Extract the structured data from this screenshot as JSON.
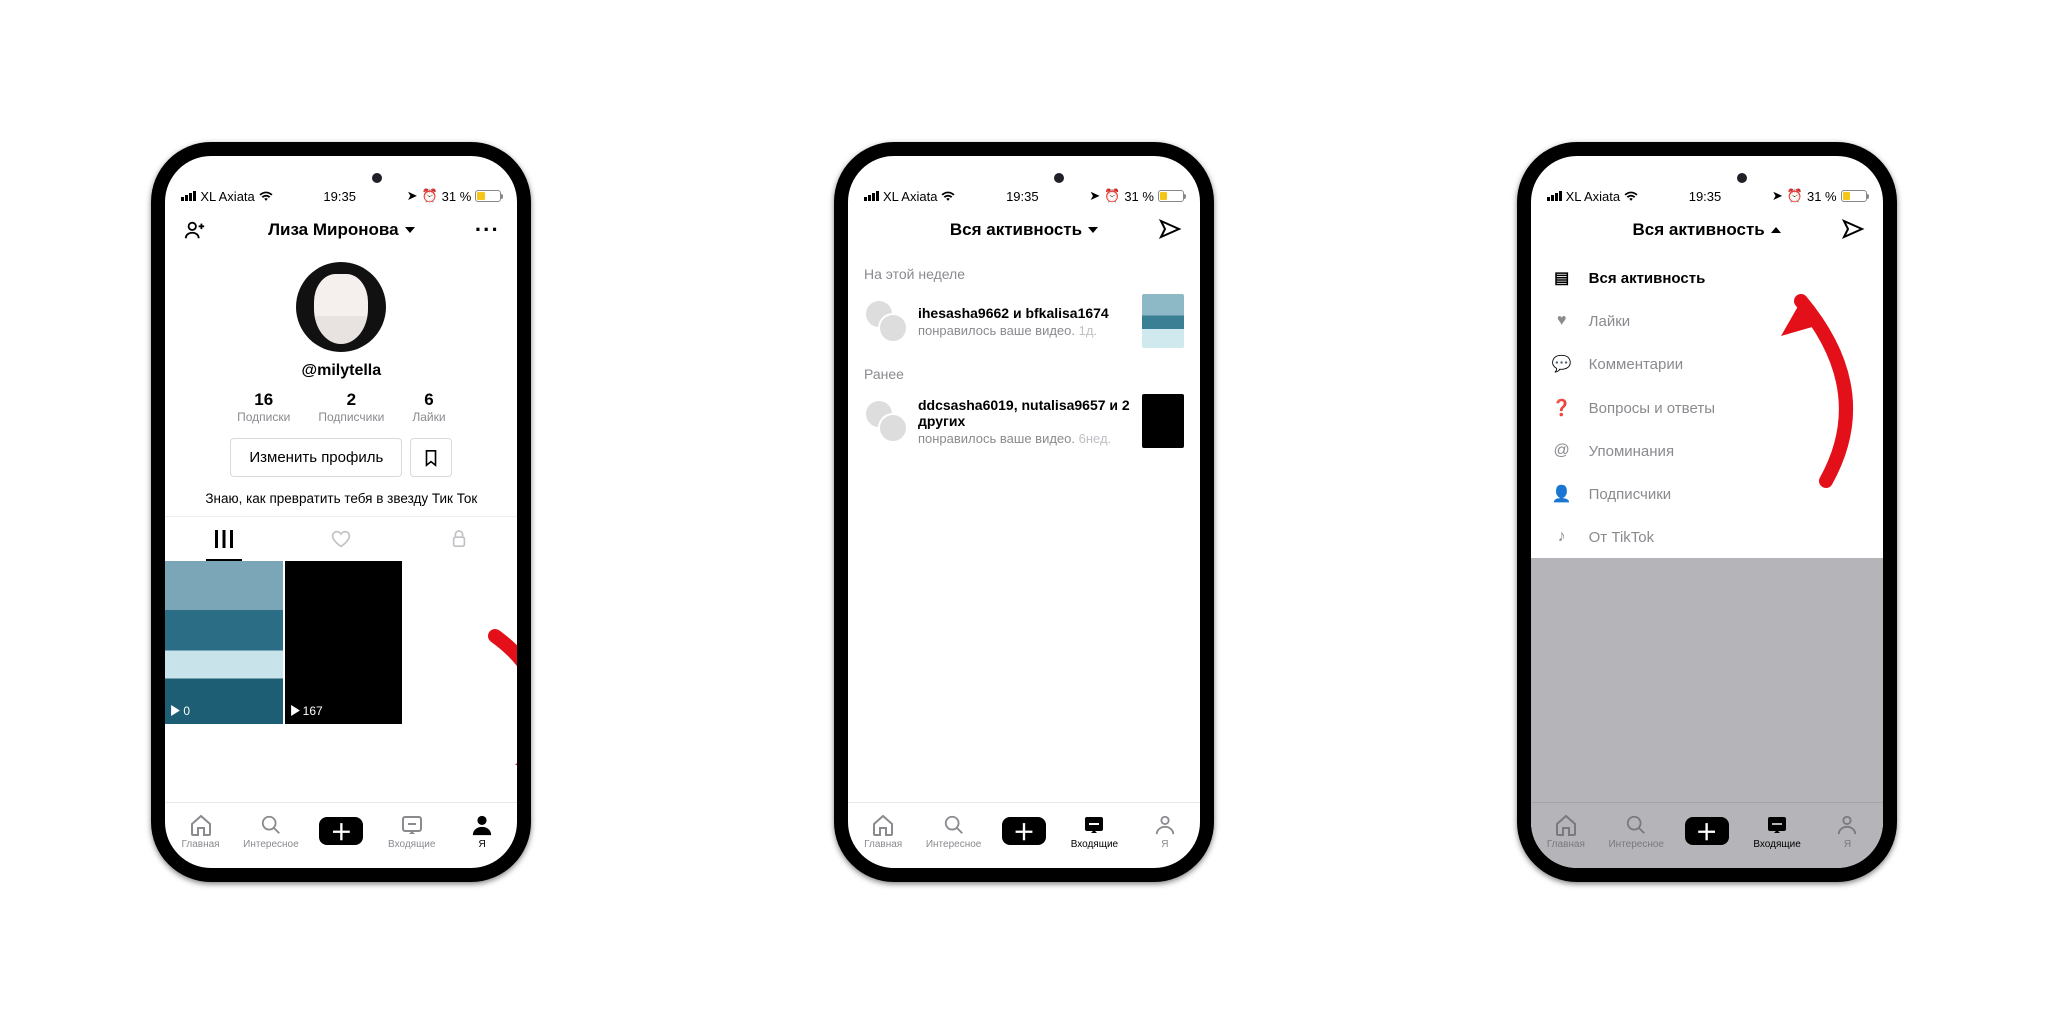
{
  "status": {
    "carrier": "XL Axiata",
    "time": "19:35",
    "battery": "31 %"
  },
  "navLabels": {
    "home": "Главная",
    "discover": "Интересное",
    "inbox": "Входящие",
    "me": "Я"
  },
  "profile": {
    "name": "Лиза Миронова",
    "handle": "@milytella",
    "stats": [
      {
        "n": "16",
        "l": "Подписки"
      },
      {
        "n": "2",
        "l": "Подписчики"
      },
      {
        "n": "6",
        "l": "Лайки"
      }
    ],
    "editBtn": "Изменить профиль",
    "bio": "Знаю, как превратить тебя в звезду Тик Ток",
    "vids": [
      {
        "plays": "0"
      },
      {
        "plays": "167"
      }
    ]
  },
  "inbox": {
    "title": "Вся активность",
    "sections": [
      {
        "title": "На этой неделе",
        "rows": [
          {
            "who": "ihesasha9662 и bfkalisa1674",
            "what": "понравилось ваше видео.",
            "when": "1д.",
            "thumb": "sea"
          }
        ]
      },
      {
        "title": "Ранее",
        "rows": [
          {
            "who": "ddcsasha6019, nutalisa9657 и 2 других",
            "what": "понравилось ваше видео.",
            "when": "6нед.",
            "thumb": "blk"
          }
        ]
      }
    ]
  },
  "filterMenu": {
    "title": "Вся активность",
    "items": [
      {
        "label": "Вся активность",
        "active": true
      },
      {
        "label": "Лайки"
      },
      {
        "label": "Комментарии"
      },
      {
        "label": "Вопросы и ответы"
      },
      {
        "label": "Упоминания"
      },
      {
        "label": "Подписчики"
      },
      {
        "label": "От TikTok"
      }
    ]
  }
}
